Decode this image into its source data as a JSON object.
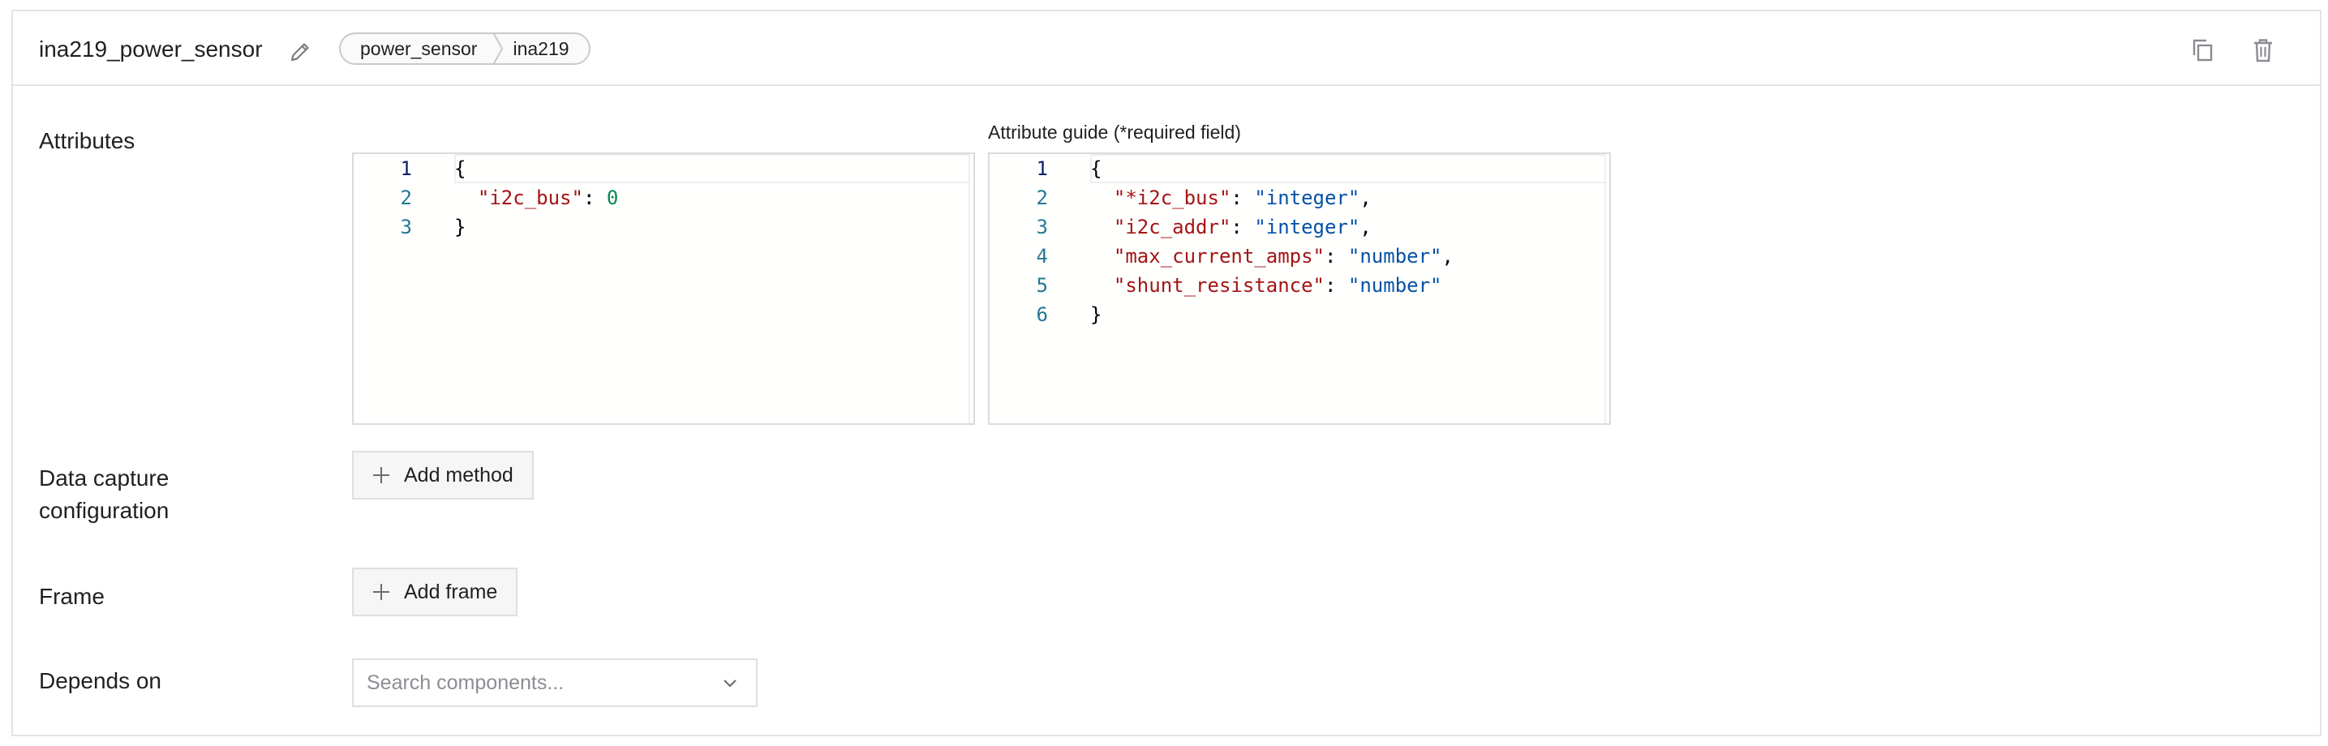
{
  "component": {
    "name": "ina219_power_sensor",
    "breadcrumb": [
      "power_sensor",
      "ina219"
    ]
  },
  "icons": {
    "edit": "pencil-icon",
    "duplicate": "copy-icon",
    "delete": "trash-icon",
    "add": "plus-icon",
    "dropdown": "chevron-down-icon"
  },
  "attributes": {
    "label": "Attributes",
    "editor": {
      "line_numbers": [
        "1",
        "2",
        "3"
      ],
      "lines": [
        [
          {
            "t": "pun",
            "v": "{"
          }
        ],
        [
          {
            "t": "pun",
            "v": "  "
          },
          {
            "t": "key",
            "v": "\"i2c_bus\""
          },
          {
            "t": "pun",
            "v": ": "
          },
          {
            "t": "num",
            "v": "0"
          }
        ],
        [
          {
            "t": "pun",
            "v": "}"
          }
        ]
      ]
    }
  },
  "guide": {
    "label": "Attribute guide (*required field)",
    "editor": {
      "line_numbers": [
        "1",
        "2",
        "3",
        "4",
        "5",
        "6"
      ],
      "lines": [
        [
          {
            "t": "pun",
            "v": "{"
          }
        ],
        [
          {
            "t": "pun",
            "v": "  "
          },
          {
            "t": "key",
            "v": "\"*i2c_bus\""
          },
          {
            "t": "pun",
            "v": ": "
          },
          {
            "t": "str",
            "v": "\"integer\""
          },
          {
            "t": "pun",
            "v": ","
          }
        ],
        [
          {
            "t": "pun",
            "v": "  "
          },
          {
            "t": "key",
            "v": "\"i2c_addr\""
          },
          {
            "t": "pun",
            "v": ": "
          },
          {
            "t": "str",
            "v": "\"integer\""
          },
          {
            "t": "pun",
            "v": ","
          }
        ],
        [
          {
            "t": "pun",
            "v": "  "
          },
          {
            "t": "key",
            "v": "\"max_current_amps\""
          },
          {
            "t": "pun",
            "v": ": "
          },
          {
            "t": "str",
            "v": "\"number\""
          },
          {
            "t": "pun",
            "v": ","
          }
        ],
        [
          {
            "t": "pun",
            "v": "  "
          },
          {
            "t": "key",
            "v": "\"shunt_resistance\""
          },
          {
            "t": "pun",
            "v": ": "
          },
          {
            "t": "str",
            "v": "\"number\""
          }
        ],
        [
          {
            "t": "pun",
            "v": "}"
          }
        ]
      ]
    }
  },
  "data_capture": {
    "label_line1": "Data capture",
    "label_line2": "configuration",
    "button_label": "Add method"
  },
  "frame": {
    "label": "Frame",
    "button_label": "Add frame"
  },
  "depends_on": {
    "label": "Depends on",
    "placeholder": "Search components..."
  },
  "colors": {
    "json_key": "#a31515",
    "json_string": "#0451a5",
    "json_number": "#098658",
    "line_number": "#237893"
  }
}
